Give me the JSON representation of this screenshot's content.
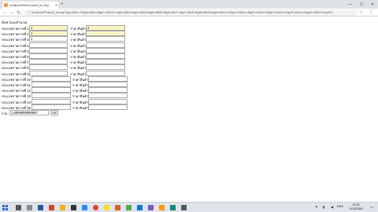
{
  "browser": {
    "tab_title": "localhost:8000/Current_ne_t/by",
    "new_tab_label": "+",
    "url": "localhost/Projectt_sd.asp?qty=&tb1=1&tgtl=&tb2=&tg2=1&tb11=&tg3=&tb4=&tg4=&tb5=&tg5=&tb6=&tg6=&tb7=&tg7=&tb8=&tg8=&tb9=&tg9=&tb10=&tg10=&tb11=&tg11=&tb12=&tg12=&tb13=&tg13=&tb14=&tg14=&tb15=&tg15=",
    "back_icon": "back-arrow-icon",
    "forward_icon": "forward-arrow-icon",
    "reload_icon": "reload-icon"
  },
  "form": {
    "heading": "ค้นหาและคำนวณ",
    "price_label": "ราคาสินค้า",
    "rows": [
      {
        "label": "ประเภทรายการที่ 1",
        "name_value": "1",
        "price_value": "2",
        "filled": true
      },
      {
        "label": "ประเภทรายการที่ 2",
        "name_value": "1",
        "price_value": "",
        "filled": true
      },
      {
        "label": "ประเภทรายการที่ 3",
        "name_value": "1",
        "price_value": "",
        "filled": false
      },
      {
        "label": "ประเภทรายการที่ 4",
        "name_value": "",
        "price_value": "",
        "filled": false
      },
      {
        "label": "ประเภทรายการที่ 5",
        "name_value": "",
        "price_value": "",
        "filled": false
      },
      {
        "label": "ประเภทรายการที่ 6",
        "name_value": "",
        "price_value": "",
        "filled": false
      },
      {
        "label": "ประเภทรายการที่ 7",
        "name_value": "",
        "price_value": "",
        "filled": false
      },
      {
        "label": "ประเภทรายการที่ 8",
        "name_value": "",
        "price_value": "",
        "filled": false
      },
      {
        "label": "ประเภทรายการที่ 9",
        "name_value": "",
        "price_value": "",
        "filled": false
      },
      {
        "label": "ประเภทรายการที่ 10",
        "name_value": "",
        "price_value": "",
        "filled": false
      },
      {
        "label": "ประเภทรายการที่ 11",
        "name_value": "",
        "price_value": "",
        "filled": false
      },
      {
        "label": "ประเภทรายการที่ 12",
        "name_value": "",
        "price_value": "",
        "filled": false
      },
      {
        "label": "ประเภทรายการที่ 13",
        "name_value": "",
        "price_value": "",
        "filled": false
      },
      {
        "label": "ประเภทรายการที่ 14",
        "name_value": "",
        "price_value": "",
        "filled": false
      },
      {
        "label": "ประเภทรายการที่ 15",
        "name_value": "",
        "price_value": "",
        "filled": false
      }
    ],
    "total_label": "รวม",
    "total_value": "1.8999999999997",
    "ok_label": "OK"
  },
  "taskbar": {
    "language": "ENG",
    "time": "10:38",
    "date": "10/10/2561"
  },
  "colors": {
    "filled_input": "#fbf6c6",
    "start_blue": "#1f6fd1"
  }
}
